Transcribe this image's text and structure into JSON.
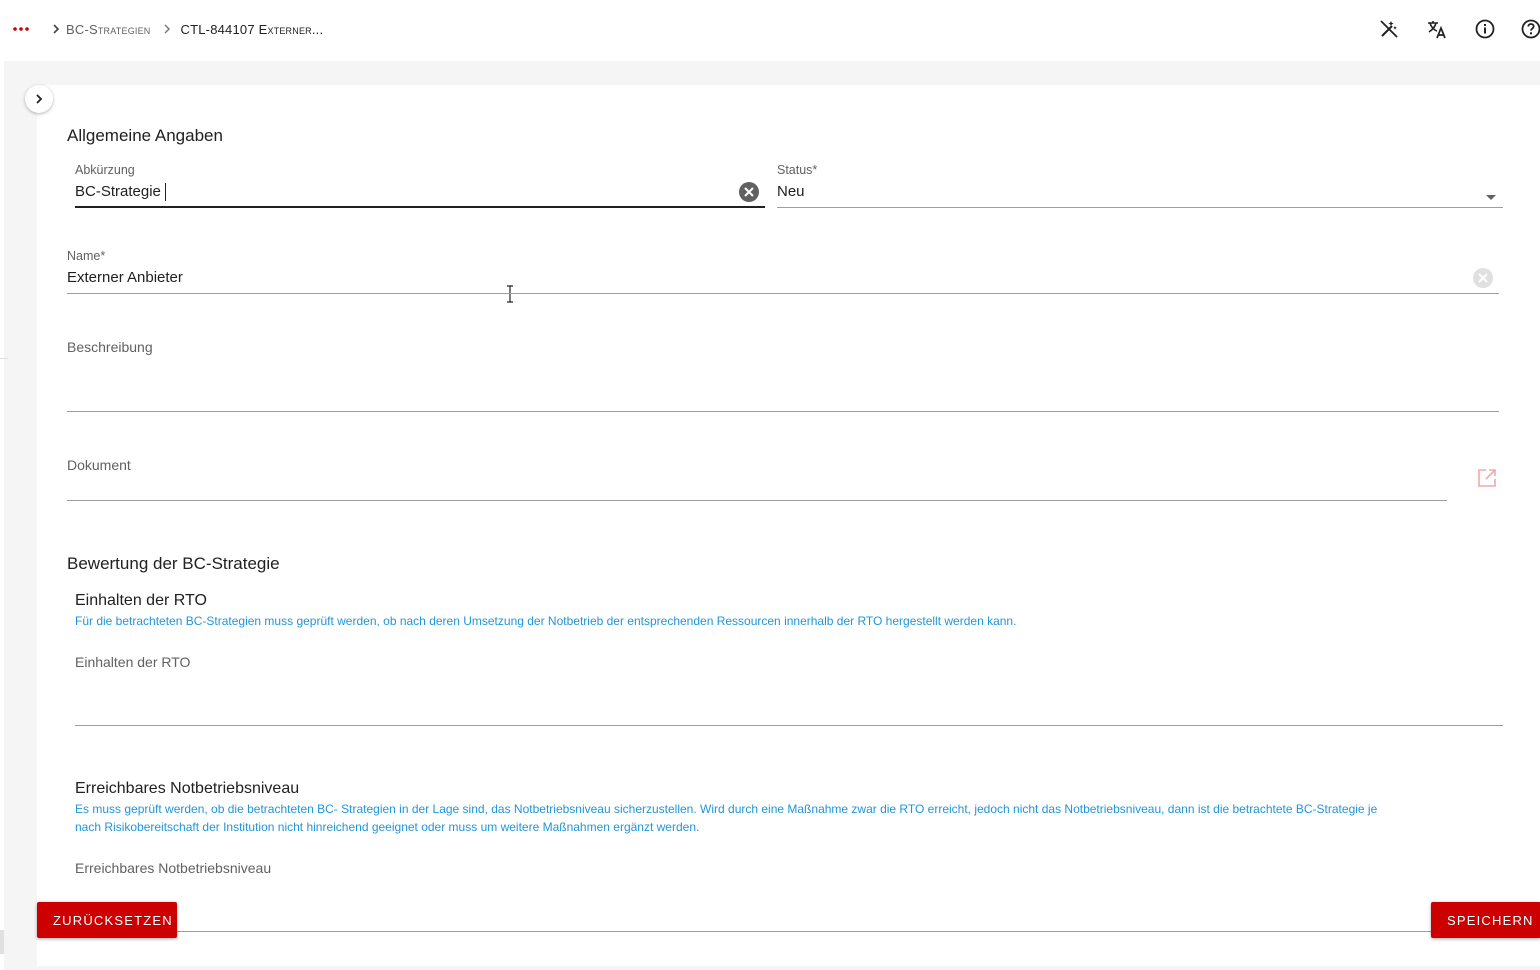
{
  "breadcrumb": {
    "items": [
      "BC-Strategien"
    ],
    "current": "CTL-844107 Externer..."
  },
  "toolbar": {
    "icons": [
      "magic-off-icon",
      "translate-icon",
      "info-icon",
      "help-icon"
    ]
  },
  "form": {
    "section_general": "Allgemeine Angaben",
    "abbreviation": {
      "label": "Abkürzung",
      "value": "BC-Strategie"
    },
    "status": {
      "label": "Status*",
      "value": "Neu"
    },
    "name": {
      "label": "Name*",
      "value": "Externer Anbieter"
    },
    "description": {
      "label": "Beschreibung",
      "value": ""
    },
    "document": {
      "label": "Dokument",
      "value": ""
    },
    "section_rating": "Bewertung der BC-Strategie",
    "rto": {
      "title": "Einhalten der RTO",
      "hint": "Für die betrachteten BC-Strategien muss geprüft werden, ob nach deren Umsetzung der Notbetrieb der entsprechenden Ressourcen innerhalb der RTO hergestellt werden kann.",
      "label": "Einhalten der RTO"
    },
    "emergency": {
      "title": "Erreichbares Notbetriebsniveau",
      "hint_line1": "Es muss geprüft werden, ob die betrachteten BC- Strategien in der Lage sind, das Notbetriebsniveau sicherzustellen. Wird durch eine Maßnahme zwar die RTO erreicht, jedoch nicht das Notbetriebsniveau, dann ist die betrachtete BC-Strategie je",
      "hint_line2": "nach Risikobereitschaft der Institution nicht hinreichend geeignet oder muss um weitere Maßnahmen ergänzt werden.",
      "label": "Erreichbares Notbetriebsniveau"
    }
  },
  "actions": {
    "reset_label": "ZURÜCKSETZEN",
    "save_label": "SPEICHERN"
  },
  "colors": {
    "accent": "#cc0000",
    "hint": "#2196d9",
    "background": "#f5f5f5"
  }
}
